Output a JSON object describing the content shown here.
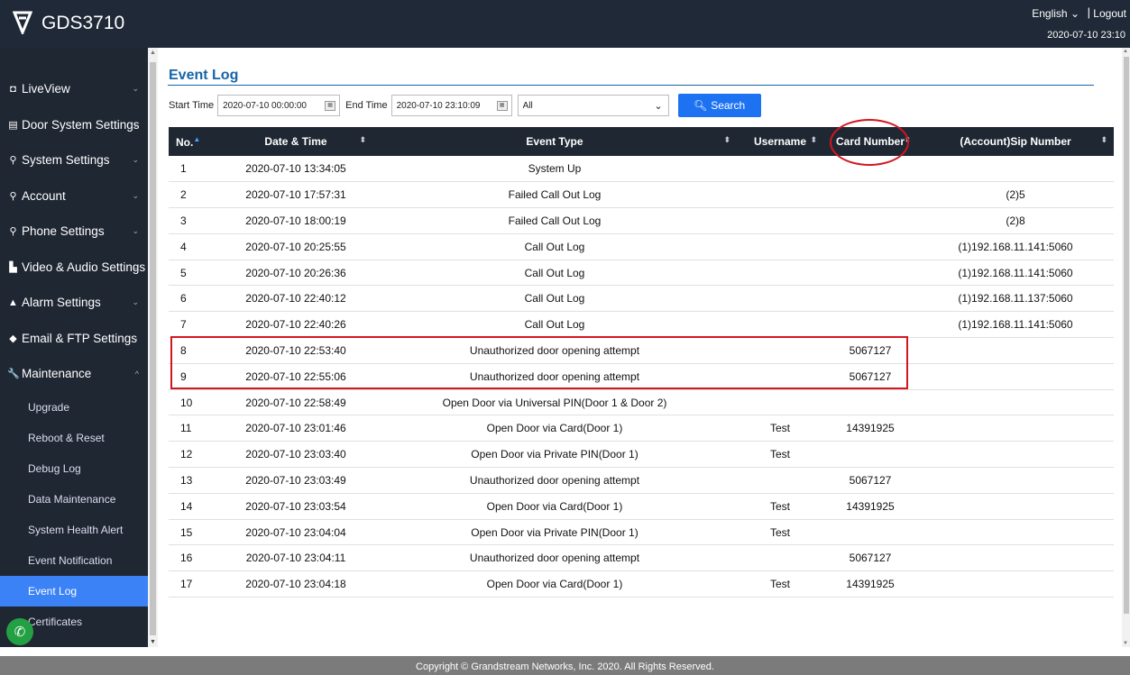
{
  "header": {
    "brand": "GDS3710",
    "language": "English",
    "language_caret": "⌄",
    "separator": "|",
    "logout": "Logout",
    "clock": "2020-07-10 23:10"
  },
  "sidebar": {
    "items": [
      {
        "label": "LiveView",
        "icon": "monitor-icon",
        "glyph": "◘",
        "chevron": "⌄"
      },
      {
        "label": "Door System Settings",
        "icon": "door-icon",
        "glyph": "▤",
        "chevron": "⌄"
      },
      {
        "label": "System Settings",
        "icon": "key-icon",
        "glyph": "⚲",
        "chevron": "⌄"
      },
      {
        "label": "Account",
        "icon": "key-icon",
        "glyph": "⚲",
        "chevron": "⌄"
      },
      {
        "label": "Phone Settings",
        "icon": "key-icon",
        "glyph": "⚲",
        "chevron": "⌄"
      },
      {
        "label": "Video & Audio Settings",
        "icon": "video-icon",
        "glyph": "▙",
        "chevron": "⌄"
      },
      {
        "label": "Alarm Settings",
        "icon": "alarm-icon",
        "glyph": "▲",
        "chevron": "⌄"
      },
      {
        "label": "Email & FTP Settings",
        "icon": "cloud-icon",
        "glyph": "◆",
        "chevron": "⌄"
      },
      {
        "label": "Maintenance",
        "icon": "wrench-icon",
        "glyph": "🔧",
        "chevron": "^"
      }
    ],
    "sub_items": [
      {
        "label": "Upgrade",
        "active": false
      },
      {
        "label": "Reboot & Reset",
        "active": false
      },
      {
        "label": "Debug Log",
        "active": false
      },
      {
        "label": "Data Maintenance",
        "active": false
      },
      {
        "label": "System Health Alert",
        "active": false
      },
      {
        "label": "Event Notification",
        "active": false
      },
      {
        "label": "Event Log",
        "active": true
      },
      {
        "label": "Certificates",
        "active": false
      }
    ]
  },
  "page": {
    "title": "Event Log"
  },
  "filter": {
    "start_label": "Start Time",
    "start_value": "2020-07-10 00:00:00",
    "end_label": "End Time",
    "end_value": "2020-07-10 23:10:09",
    "type_value": "All",
    "search_label": "Search"
  },
  "table": {
    "headers": {
      "no": "No.",
      "datetime": "Date & Time",
      "event_type": "Event Type",
      "username": "Username",
      "card_number": "Card Number",
      "sip_number": "(Account)Sip Number"
    },
    "rows": [
      {
        "no": "1",
        "datetime": "2020-07-10 13:34:05",
        "event": "System Up",
        "user": "",
        "card": "",
        "sip": ""
      },
      {
        "no": "2",
        "datetime": "2020-07-10 17:57:31",
        "event": "Failed Call Out Log",
        "user": "",
        "card": "",
        "sip": "(2)5"
      },
      {
        "no": "3",
        "datetime": "2020-07-10 18:00:19",
        "event": "Failed Call Out Log",
        "user": "",
        "card": "",
        "sip": "(2)8"
      },
      {
        "no": "4",
        "datetime": "2020-07-10 20:25:55",
        "event": "Call Out Log",
        "user": "",
        "card": "",
        "sip": "(1)192.168.11.141:5060"
      },
      {
        "no": "5",
        "datetime": "2020-07-10 20:26:36",
        "event": "Call Out Log",
        "user": "",
        "card": "",
        "sip": "(1)192.168.11.141:5060"
      },
      {
        "no": "6",
        "datetime": "2020-07-10 22:40:12",
        "event": "Call Out Log",
        "user": "",
        "card": "",
        "sip": "(1)192.168.11.137:5060"
      },
      {
        "no": "7",
        "datetime": "2020-07-10 22:40:26",
        "event": "Call Out Log",
        "user": "",
        "card": "",
        "sip": "(1)192.168.11.141:5060"
      },
      {
        "no": "8",
        "datetime": "2020-07-10 22:53:40",
        "event": "Unauthorized door opening attempt",
        "user": "",
        "card": "5067127",
        "sip": ""
      },
      {
        "no": "9",
        "datetime": "2020-07-10 22:55:06",
        "event": "Unauthorized door opening attempt",
        "user": "",
        "card": "5067127",
        "sip": ""
      },
      {
        "no": "10",
        "datetime": "2020-07-10 22:58:49",
        "event": "Open Door via Universal PIN(Door 1 & Door 2)",
        "user": "",
        "card": "",
        "sip": ""
      },
      {
        "no": "11",
        "datetime": "2020-07-10 23:01:46",
        "event": "Open Door via Card(Door 1)",
        "user": "Test",
        "card": "14391925",
        "sip": ""
      },
      {
        "no": "12",
        "datetime": "2020-07-10 23:03:40",
        "event": "Open Door via Private PIN(Door 1)",
        "user": "Test",
        "card": "",
        "sip": ""
      },
      {
        "no": "13",
        "datetime": "2020-07-10 23:03:49",
        "event": "Unauthorized door opening attempt",
        "user": "",
        "card": "5067127",
        "sip": ""
      },
      {
        "no": "14",
        "datetime": "2020-07-10 23:03:54",
        "event": "Open Door via Card(Door 1)",
        "user": "Test",
        "card": "14391925",
        "sip": ""
      },
      {
        "no": "15",
        "datetime": "2020-07-10 23:04:04",
        "event": "Open Door via Private PIN(Door 1)",
        "user": "Test",
        "card": "",
        "sip": ""
      },
      {
        "no": "16",
        "datetime": "2020-07-10 23:04:11",
        "event": "Unauthorized door opening attempt",
        "user": "",
        "card": "5067127",
        "sip": ""
      },
      {
        "no": "17",
        "datetime": "2020-07-10 23:04:18",
        "event": "Open Door via Card(Door 1)",
        "user": "Test",
        "card": "14391925",
        "sip": ""
      }
    ]
  },
  "footer": {
    "copyright": "Copyright © Grandstream Networks, Inc. 2020. All Rights Reserved."
  },
  "colors": {
    "header_bg": "#1f2937",
    "sidebar_bg": "#1f2733",
    "active_item": "#3b82f6",
    "title_blue": "#1565a8",
    "search_button": "#1d72f2",
    "annotation_red": "#d2161f",
    "footer_bg": "#7b7b7b"
  }
}
